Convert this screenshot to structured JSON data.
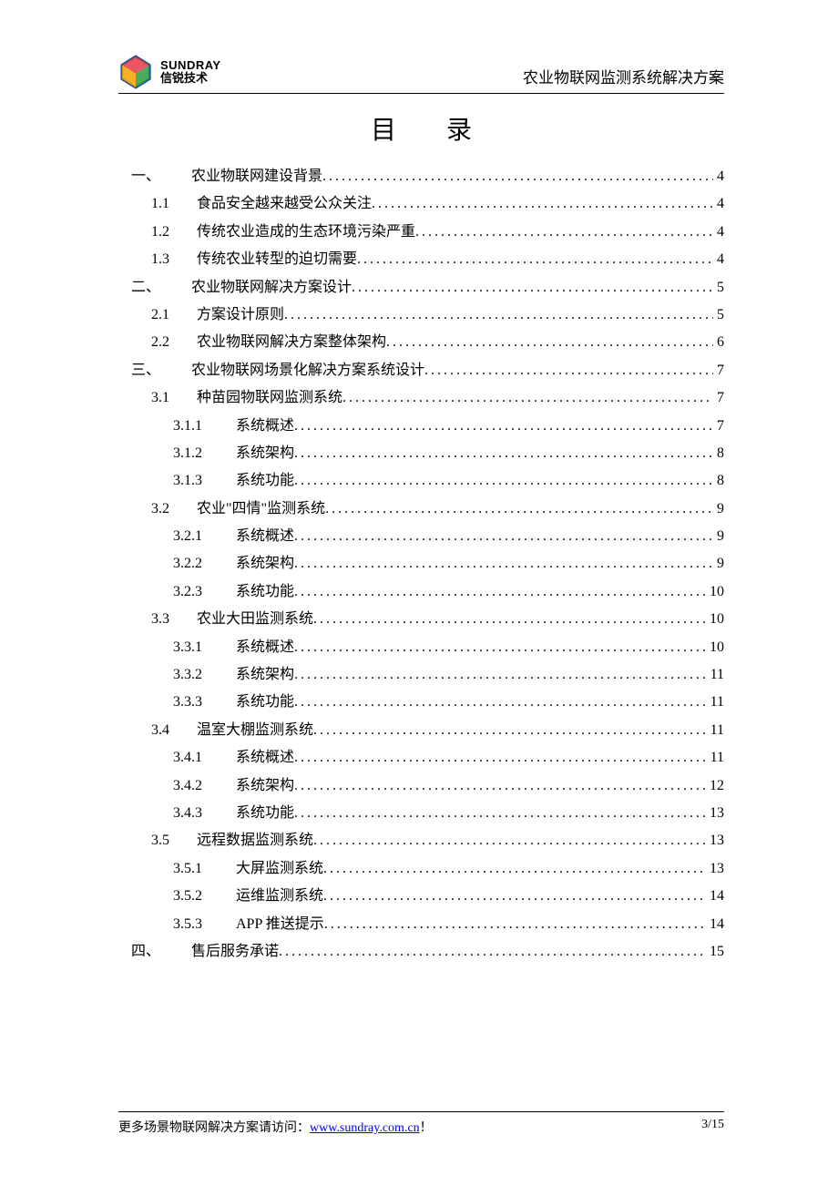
{
  "header": {
    "logo_en": "SUNDRAY",
    "logo_cn": "信锐技术",
    "doc_title": "农业物联网监测系统解决方案"
  },
  "toc_heading": "目 录",
  "toc": [
    {
      "level": 0,
      "num": "一、",
      "label": "农业物联网建设背景",
      "page": "4"
    },
    {
      "level": 1,
      "num": "1.1",
      "label": "食品安全越来越受公众关注",
      "page": "4"
    },
    {
      "level": 1,
      "num": "1.2",
      "label": "传统农业造成的生态环境污染严重",
      "page": "4"
    },
    {
      "level": 1,
      "num": "1.3",
      "label": "传统农业转型的迫切需要",
      "page": "4"
    },
    {
      "level": 0,
      "num": "二、",
      "label": "农业物联网解决方案设计",
      "page": "5"
    },
    {
      "level": 1,
      "num": "2.1",
      "label": "方案设计原则",
      "page": "5"
    },
    {
      "level": 1,
      "num": "2.2",
      "label": "农业物联网解决方案整体架构",
      "page": "6"
    },
    {
      "level": 0,
      "num": "三、",
      "label": "农业物联网场景化解决方案系统设计",
      "page": "7"
    },
    {
      "level": 1,
      "num": "3.1",
      "label": "种苗园物联网监测系统",
      "page": "7"
    },
    {
      "level": 2,
      "num": "3.1.1",
      "label": "系统概述",
      "page": "7"
    },
    {
      "level": 2,
      "num": "3.1.2",
      "label": "系统架构",
      "page": "8"
    },
    {
      "level": 2,
      "num": "3.1.3",
      "label": "系统功能",
      "page": "8"
    },
    {
      "level": 1,
      "num": "3.2",
      "label": "农业\"四情\"监测系统",
      "page": "9"
    },
    {
      "level": 2,
      "num": "3.2.1",
      "label": "系统概述",
      "page": "9"
    },
    {
      "level": 2,
      "num": "3.2.2",
      "label": "系统架构",
      "page": "9"
    },
    {
      "level": 2,
      "num": "3.2.3",
      "label": "系统功能",
      "page": "10"
    },
    {
      "level": 1,
      "num": "3.3",
      "label": "农业大田监测系统",
      "page": "10"
    },
    {
      "level": 2,
      "num": "3.3.1",
      "label": "系统概述",
      "page": "10"
    },
    {
      "level": 2,
      "num": "3.3.2",
      "label": "系统架构",
      "page": "11"
    },
    {
      "level": 2,
      "num": "3.3.3",
      "label": "系统功能",
      "page": "11"
    },
    {
      "level": 1,
      "num": "3.4",
      "label": "温室大棚监测系统",
      "page": "11"
    },
    {
      "level": 2,
      "num": "3.4.1",
      "label": "系统概述",
      "page": "11"
    },
    {
      "level": 2,
      "num": "3.4.2",
      "label": "系统架构",
      "page": "12"
    },
    {
      "level": 2,
      "num": "3.4.3",
      "label": "系统功能",
      "page": "13"
    },
    {
      "level": 1,
      "num": "3.5",
      "label": "远程数据监测系统",
      "page": "13"
    },
    {
      "level": 2,
      "num": "3.5.1",
      "label": "大屏监测系统",
      "page": "13"
    },
    {
      "level": 2,
      "num": "3.5.2",
      "label": "运维监测系统",
      "page": "14"
    },
    {
      "level": 2,
      "num": "3.5.3",
      "label": "APP 推送提示",
      "page": "14"
    },
    {
      "level": 0,
      "num": "四、",
      "label": "售后服务承诺",
      "page": "15"
    }
  ],
  "footer": {
    "prefix": "更多场景物联网解决方案请访问：",
    "link_text": "www.sundray.com.cn",
    "suffix": "！",
    "page_indicator": "3/15"
  }
}
